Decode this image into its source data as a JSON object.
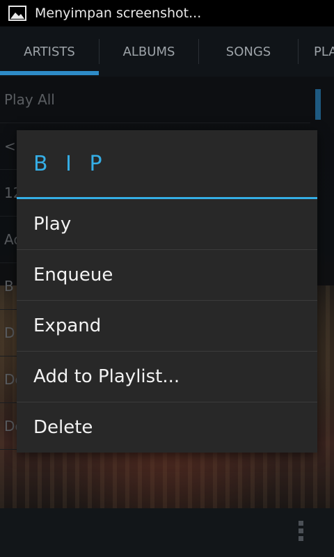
{
  "status_bar": {
    "notification_text": "Menyimpan screenshot..."
  },
  "tabs": [
    "ARTISTS",
    "ALBUMS",
    "SONGS",
    "PLA"
  ],
  "list": {
    "rows": [
      "Play All",
      "<u",
      "12",
      "Ac",
      "B",
      "D",
      "De",
      "De"
    ]
  },
  "dialog": {
    "title": "B I P",
    "items": [
      "Play",
      "Enqueue",
      "Expand",
      "Add to Playlist...",
      "Delete"
    ]
  },
  "colors": {
    "accent": "#35aee6",
    "tab_indicator": "#2e8bc7"
  }
}
